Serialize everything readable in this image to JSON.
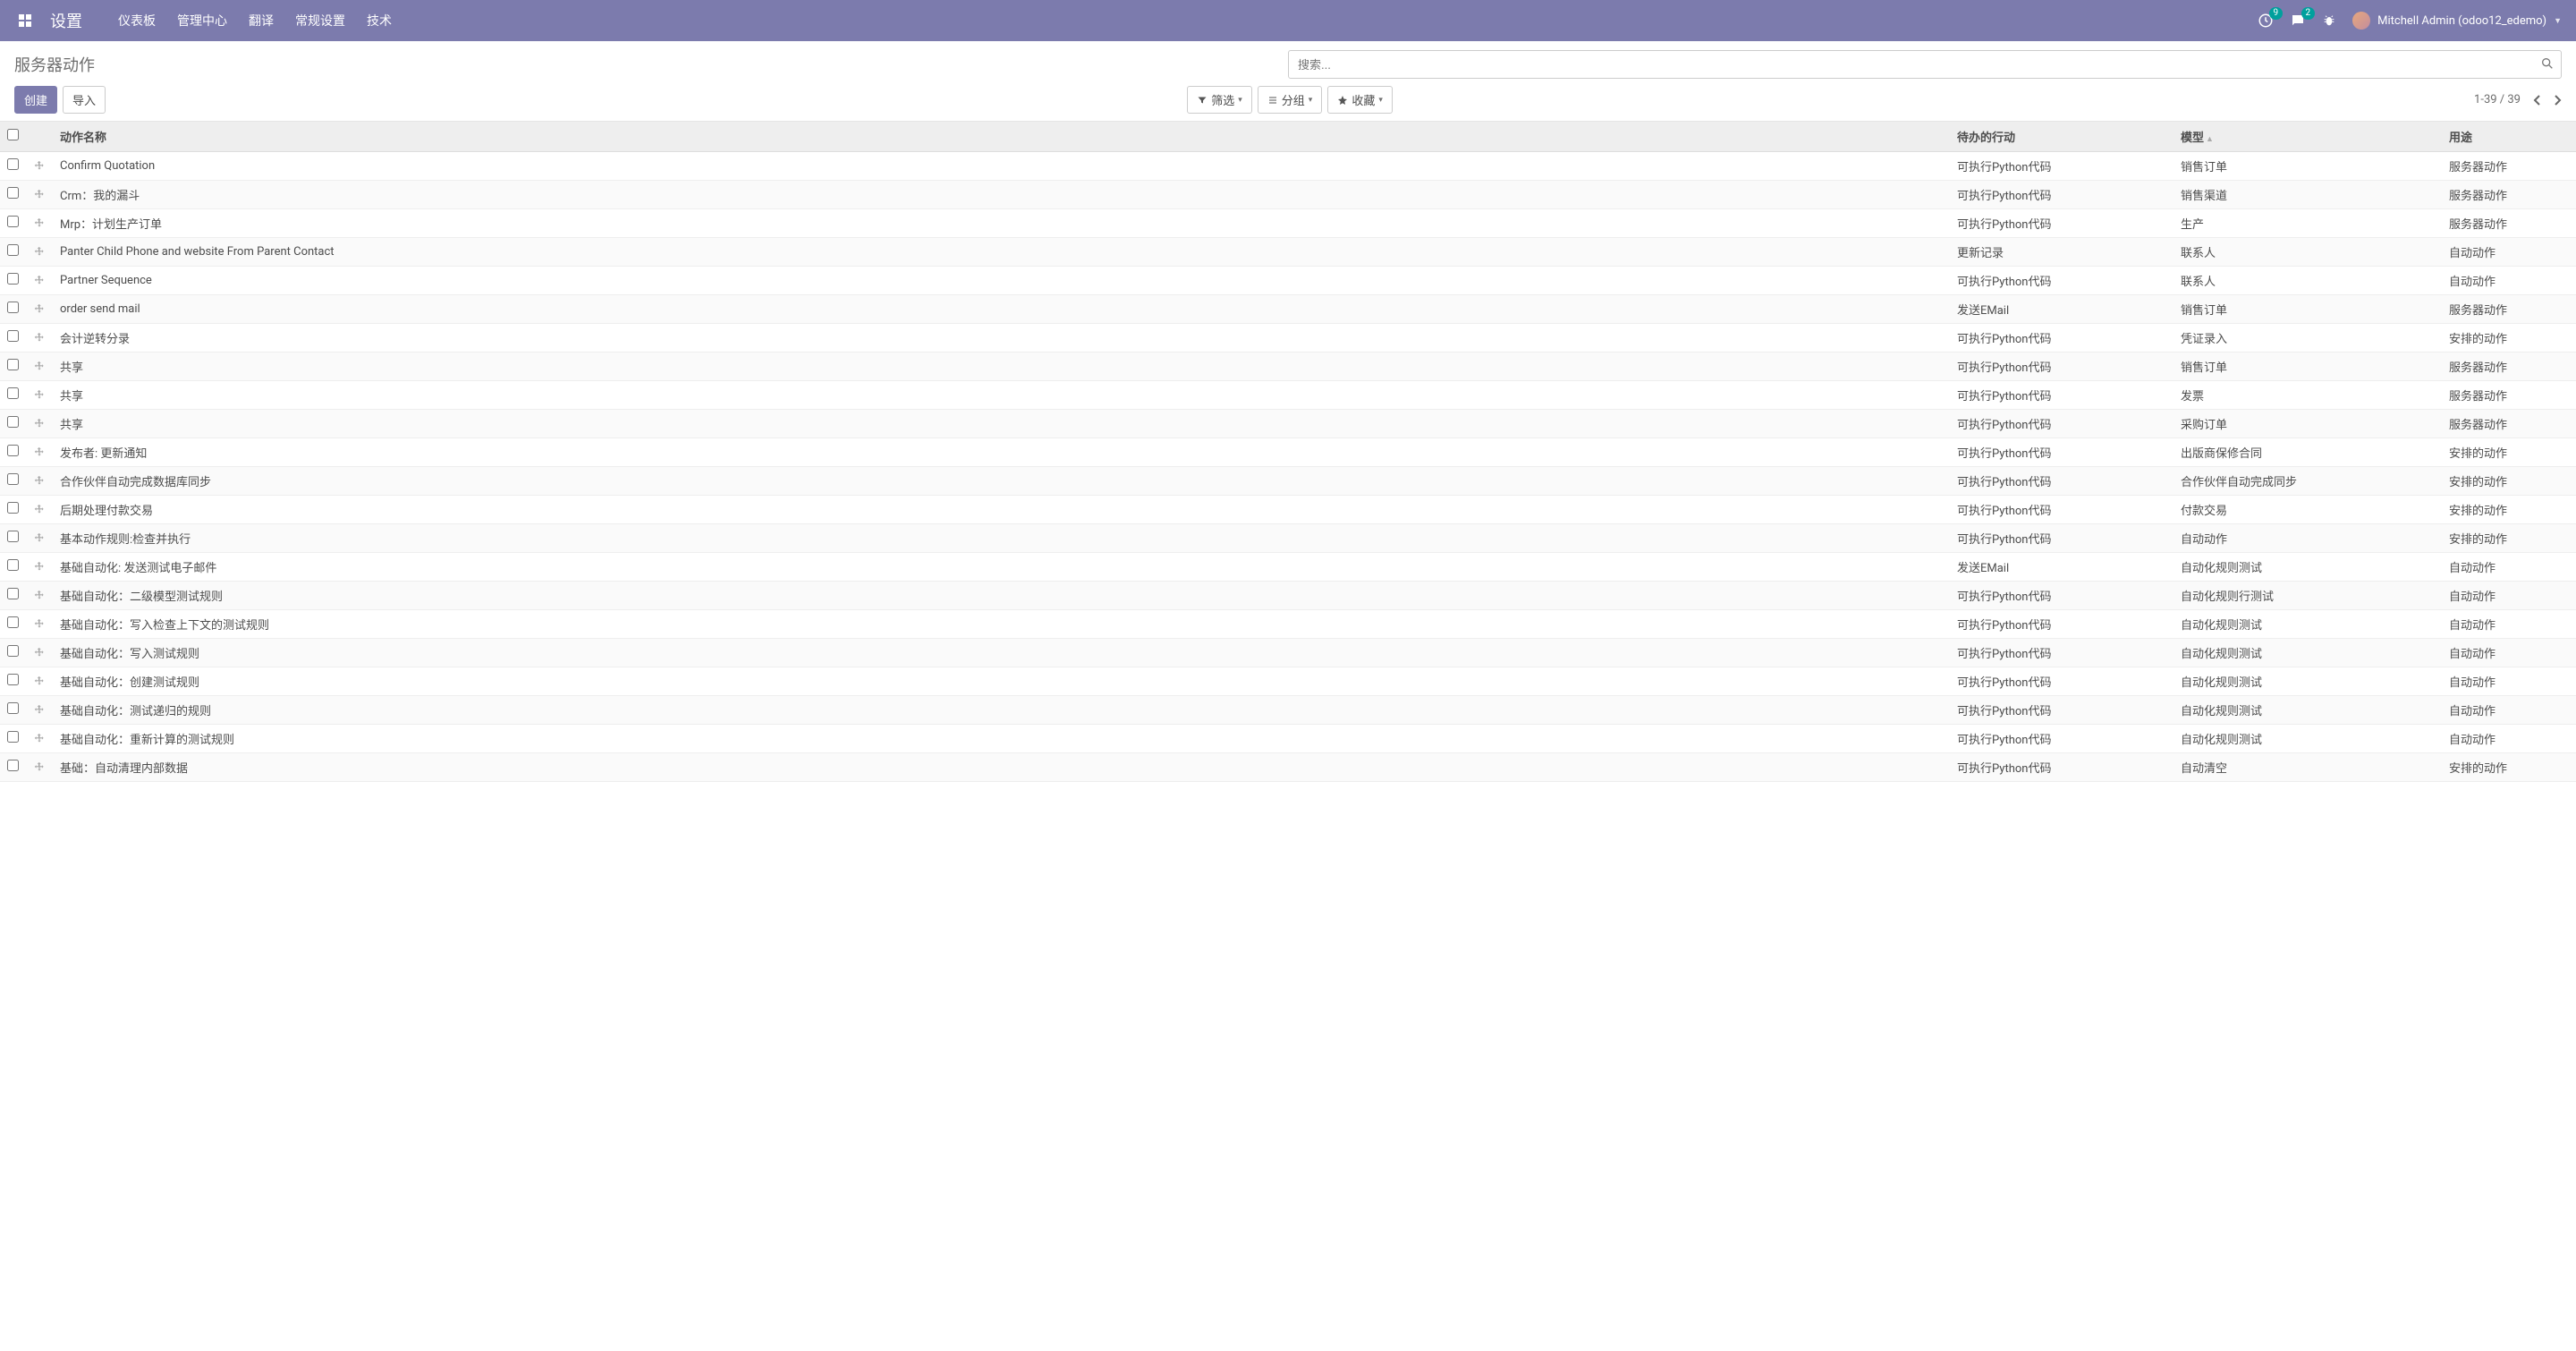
{
  "nav": {
    "brand": "设置",
    "items": [
      "仪表板",
      "管理中心",
      "翻译",
      "常规设置",
      "技术"
    ],
    "clock_badge": "9",
    "chat_badge": "2",
    "user": "Mitchell Admin (odoo12_edemo)"
  },
  "cp": {
    "breadcrumb": "服务器动作",
    "search_placeholder": "搜索...",
    "btn_create": "创建",
    "btn_import": "导入",
    "filter": "筛选",
    "group": "分组",
    "favorite": "收藏",
    "pager": "1-39 / 39"
  },
  "table": {
    "headers": {
      "name": "动作名称",
      "state": "待办的行动",
      "model": "模型",
      "usage": "用途"
    },
    "rows": [
      {
        "name": "Confirm Quotation",
        "state": "可执行Python代码",
        "model": "销售订单",
        "usage": "服务器动作"
      },
      {
        "name": "Crm：我的漏斗",
        "state": "可执行Python代码",
        "model": "销售渠道",
        "usage": "服务器动作"
      },
      {
        "name": "Mrp：计划生产订单",
        "state": "可执行Python代码",
        "model": "生产",
        "usage": "服务器动作"
      },
      {
        "name": "Panter Child Phone and website From Parent Contact",
        "state": "更新记录",
        "model": "联系人",
        "usage": "自动动作"
      },
      {
        "name": "Partner Sequence",
        "state": "可执行Python代码",
        "model": "联系人",
        "usage": "自动动作"
      },
      {
        "name": "order send mail",
        "state": "发送EMail",
        "model": "销售订单",
        "usage": "服务器动作"
      },
      {
        "name": "会计逆转分录",
        "state": "可执行Python代码",
        "model": "凭证录入",
        "usage": "安排的动作"
      },
      {
        "name": "共享",
        "state": "可执行Python代码",
        "model": "销售订单",
        "usage": "服务器动作"
      },
      {
        "name": "共享",
        "state": "可执行Python代码",
        "model": "发票",
        "usage": "服务器动作"
      },
      {
        "name": "共享",
        "state": "可执行Python代码",
        "model": "采购订单",
        "usage": "服务器动作"
      },
      {
        "name": "发布者: 更新通知",
        "state": "可执行Python代码",
        "model": "出版商保修合同",
        "usage": "安排的动作"
      },
      {
        "name": "合作伙伴自动完成数据库同步",
        "state": "可执行Python代码",
        "model": "合作伙伴自动完成同步",
        "usage": "安排的动作"
      },
      {
        "name": "后期处理付款交易",
        "state": "可执行Python代码",
        "model": "付款交易",
        "usage": "安排的动作"
      },
      {
        "name": "基本动作规则:检查并执行",
        "state": "可执行Python代码",
        "model": "自动动作",
        "usage": "安排的动作"
      },
      {
        "name": "基础自动化: 发送测试电子邮件",
        "state": "发送EMail",
        "model": "自动化规则测试",
        "usage": "自动动作"
      },
      {
        "name": "基础自动化：二级模型测试规则",
        "state": "可执行Python代码",
        "model": "自动化规则行测试",
        "usage": "自动动作"
      },
      {
        "name": "基础自动化：写入检查上下文的测试规则",
        "state": "可执行Python代码",
        "model": "自动化规则测试",
        "usage": "自动动作"
      },
      {
        "name": "基础自动化：写入测试规则",
        "state": "可执行Python代码",
        "model": "自动化规则测试",
        "usage": "自动动作"
      },
      {
        "name": "基础自动化：创建测试规则",
        "state": "可执行Python代码",
        "model": "自动化规则测试",
        "usage": "自动动作"
      },
      {
        "name": "基础自动化：测试递归的规则",
        "state": "可执行Python代码",
        "model": "自动化规则测试",
        "usage": "自动动作"
      },
      {
        "name": "基础自动化：重新计算的测试规则",
        "state": "可执行Python代码",
        "model": "自动化规则测试",
        "usage": "自动动作"
      },
      {
        "name": "基础：自动清理内部数据",
        "state": "可执行Python代码",
        "model": "自动清空",
        "usage": "安排的动作"
      }
    ]
  }
}
